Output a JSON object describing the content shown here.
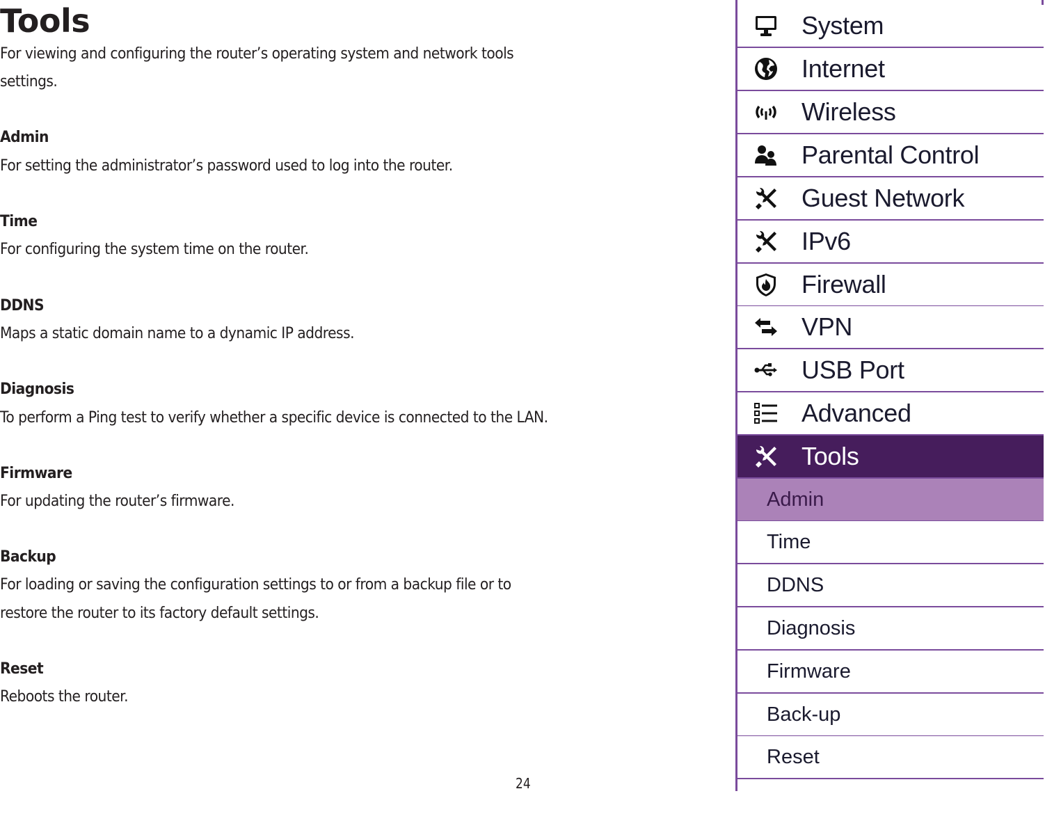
{
  "document": {
    "title": "Tools",
    "intro_lines": [
      "For viewing and configuring the router’s operating system and network tools",
      "settings."
    ],
    "sections": [
      {
        "heading": "Admin",
        "lines": [
          "For setting the administrator’s password used to log into the router."
        ]
      },
      {
        "heading": "Time",
        "lines": [
          "For configuring the system time on the router."
        ]
      },
      {
        "heading": "DDNS",
        "lines": [
          "Maps a static domain name to a dynamic IP address."
        ]
      },
      {
        "heading": "Diagnosis",
        "lines": [
          "To perform a Ping test to verify whether a specific device is connected to the LAN."
        ]
      },
      {
        "heading": "Firmware",
        "lines": [
          "For updating the router’s firmware."
        ]
      },
      {
        "heading": "Backup",
        "lines": [
          "For loading or saving the configuration settings to or from a backup file or to",
          "restore the router to its factory default settings."
        ]
      },
      {
        "heading": "Reset",
        "lines": [
          "Reboots the router."
        ]
      }
    ],
    "page_number": "24"
  },
  "menu": {
    "colors": {
      "border": "#7a4b9c",
      "active_bg": "#461d5c",
      "selected_bg": "#ab82b8"
    },
    "main_items": [
      {
        "label": "System",
        "icon": "monitor-icon"
      },
      {
        "label": "Internet",
        "icon": "globe-icon"
      },
      {
        "label": "Wireless",
        "icon": "wireless-signal-icon"
      },
      {
        "label": "Parental Control",
        "icon": "users-icon"
      },
      {
        "label": "Guest Network",
        "icon": "tools-icon"
      },
      {
        "label": "IPv6",
        "icon": "tools-icon"
      },
      {
        "label": "Firewall",
        "icon": "shield-fire-icon"
      },
      {
        "label": "VPN",
        "icon": "exchange-arrows-icon"
      },
      {
        "label": "USB Port",
        "icon": "usb-icon"
      },
      {
        "label": "Advanced",
        "icon": "list-icon"
      },
      {
        "label": "Tools",
        "icon": "tools-icon",
        "active": true
      }
    ],
    "sub_items": [
      {
        "label": "Admin",
        "selected": true
      },
      {
        "label": "Time"
      },
      {
        "label": "DDNS"
      },
      {
        "label": "Diagnosis"
      },
      {
        "label": "Firmware"
      },
      {
        "label": "Back-up"
      },
      {
        "label": "Reset"
      }
    ]
  }
}
